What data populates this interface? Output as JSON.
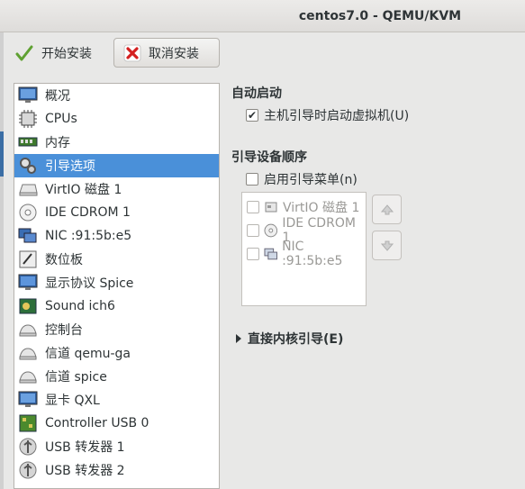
{
  "window": {
    "title": "centos7.0 - QEMU/KVM"
  },
  "toolbar": {
    "start_label": "开始安装",
    "cancel_label": "取消安装"
  },
  "devices": [
    {
      "label": "概况",
      "icon": "monitor-icon"
    },
    {
      "label": "CPUs",
      "icon": "cpu-icon"
    },
    {
      "label": "内存",
      "icon": "memory-icon"
    },
    {
      "label": "引导选项",
      "icon": "boot-options-icon",
      "selected": true
    },
    {
      "label": "VirtIO 磁盘 1",
      "icon": "disk-icon"
    },
    {
      "label": "IDE CDROM 1",
      "icon": "cdrom-icon"
    },
    {
      "label": "NIC :91:5b:e5",
      "icon": "nic-icon"
    },
    {
      "label": "数位板",
      "icon": "tablet-icon"
    },
    {
      "label": "显示协议 Spice",
      "icon": "display-icon"
    },
    {
      "label": "Sound ich6",
      "icon": "sound-icon"
    },
    {
      "label": "控制台",
      "icon": "serial-icon"
    },
    {
      "label": "信道 qemu-ga",
      "icon": "channel-icon"
    },
    {
      "label": "信道 spice",
      "icon": "channel-icon"
    },
    {
      "label": "显卡 QXL",
      "icon": "video-icon"
    },
    {
      "label": "Controller USB 0",
      "icon": "usb-controller-icon"
    },
    {
      "label": "USB 转发器 1",
      "icon": "usb-redirector-icon"
    },
    {
      "label": "USB 转发器 2",
      "icon": "usb-redirector-icon"
    }
  ],
  "autostart": {
    "header": "自动启动",
    "checkbox_label": "主机引导时启动虚拟机(U)",
    "checked": true
  },
  "boot_order": {
    "header": "引导设备顺序",
    "menu_label": "启用引导菜单(n)",
    "menu_checked": false,
    "items": [
      {
        "label": "VirtIO 磁盘 1",
        "icon": "disk-icon"
      },
      {
        "label": "IDE CDROM 1",
        "icon": "cdrom-icon"
      },
      {
        "label": "NIC :91:5b:e5",
        "icon": "nic-icon"
      }
    ]
  },
  "direct_kernel": {
    "label": "直接内核引导(E)"
  },
  "colors": {
    "selection": "#4a90d9",
    "window_bg": "#e8e8e7",
    "text": "#2e3436"
  }
}
